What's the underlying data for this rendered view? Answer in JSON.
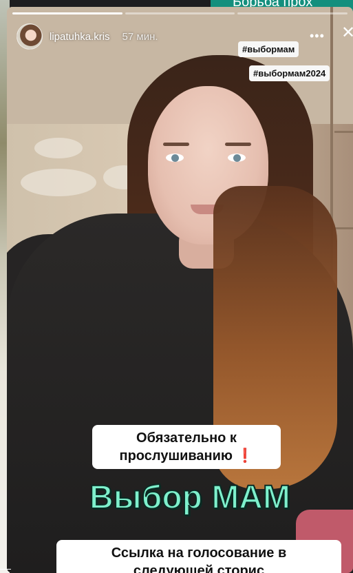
{
  "background": {
    "banner_text": "Борьба прох"
  },
  "story": {
    "username": "lipatuhka.kris",
    "time_ago": "57 мин.",
    "more_icon": "more-horizontal-icon",
    "close_icon": "close-icon",
    "tags": [
      "#выбормам",
      "#выбормам2024"
    ],
    "caption_line1": "Обязательно к",
    "caption_line2": "прослушиванию",
    "caption_mark": "❗",
    "headline": "Выбор МАМ",
    "link_line1": "Ссылка на голосование в",
    "link_line2": "следующей сторис"
  },
  "colors": {
    "headline": "#7ef0cc",
    "banner": "#138f7d",
    "exclamation": "#e02020"
  }
}
